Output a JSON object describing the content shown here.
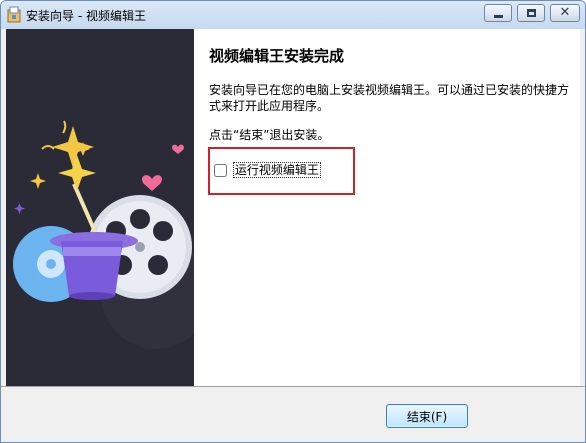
{
  "window": {
    "title": "安装向导 - 视频编辑王"
  },
  "content": {
    "heading": "视频编辑王安装完成",
    "description": "安装向导已在您的电脑上安装视频编辑王。可以通过已安装的快捷方式来打开此应用程序。",
    "hint": "点击“结束”退出安装。",
    "run_checkbox": {
      "label": "运行视频编辑王",
      "checked": false
    }
  },
  "footer": {
    "finish_label": "结束(F)"
  },
  "colors": {
    "sidebar": "#2a2b37",
    "highlight_border": "#cc2228",
    "title_bar": "#dbe8f6"
  },
  "icons": [
    "installer-icon",
    "minimize-icon",
    "maximize-icon",
    "close-icon",
    "magic-hat-illustration",
    "film-reel-icon"
  ]
}
